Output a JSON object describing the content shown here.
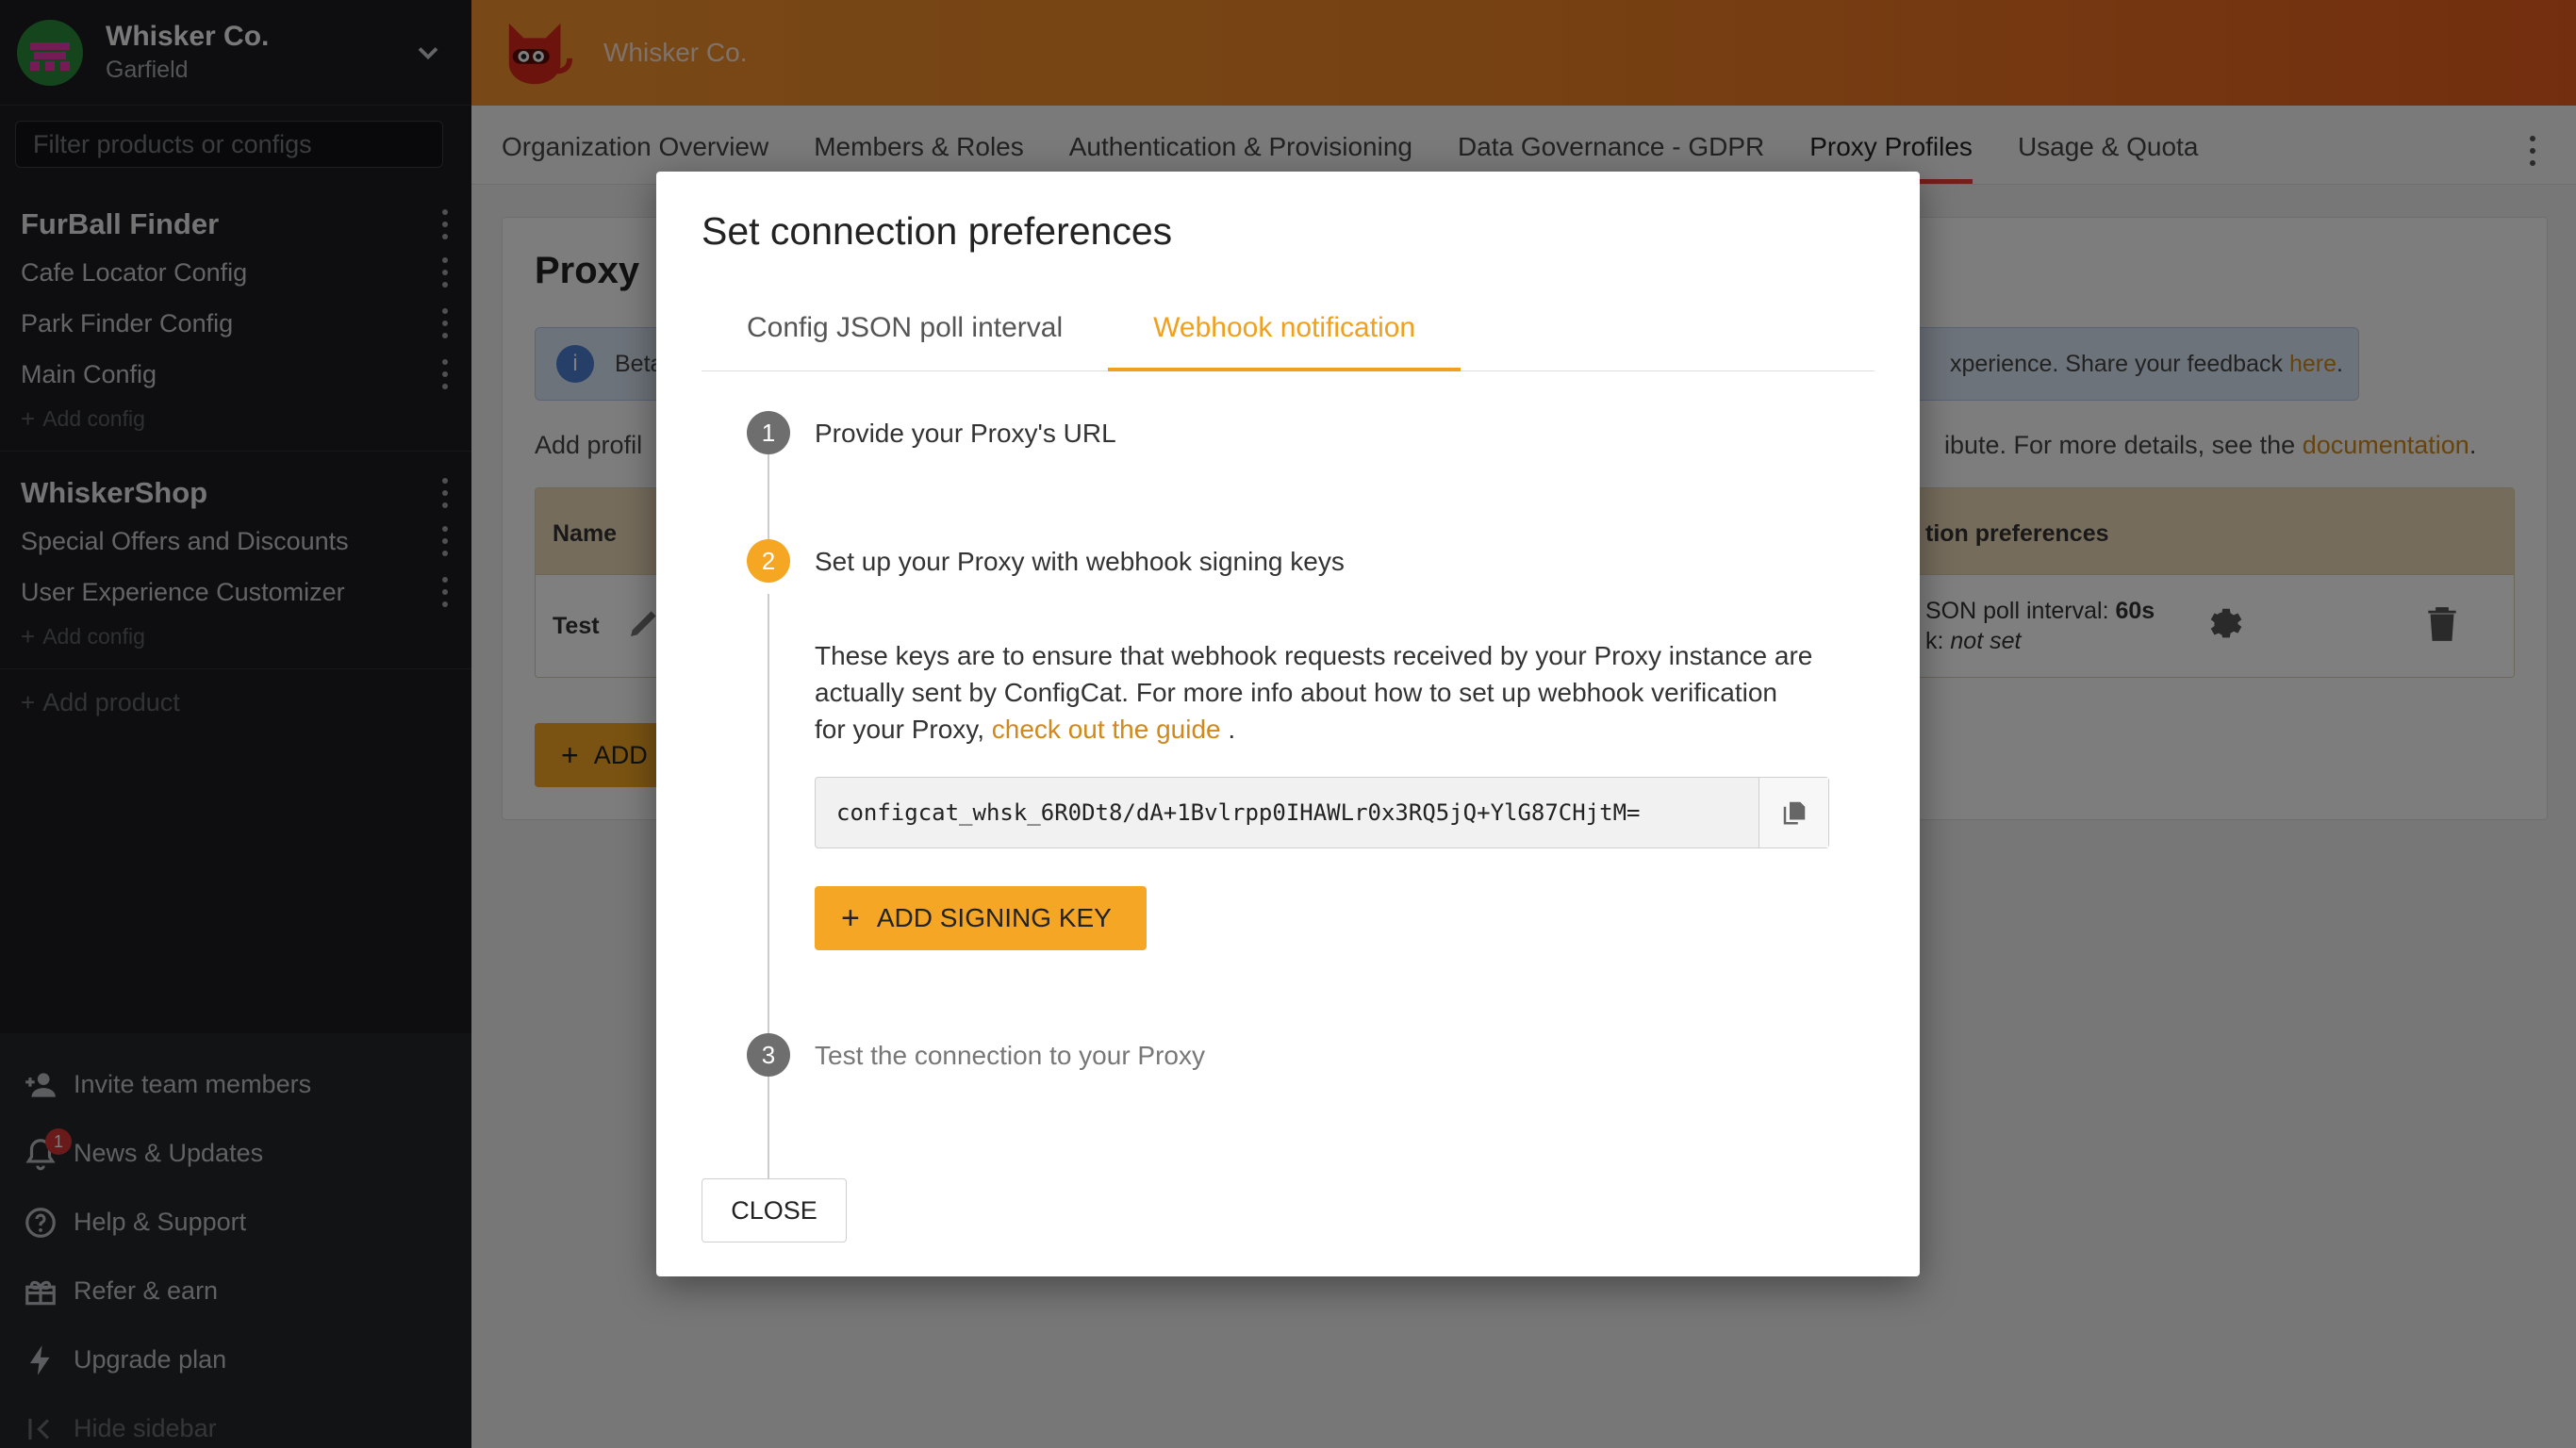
{
  "org": {
    "name": "Whisker Co.",
    "user": "Garfield"
  },
  "filter": {
    "placeholder": "Filter products or configs"
  },
  "products": [
    {
      "name": "FurBall Finder",
      "configs": [
        "Cafe Locator Config",
        "Park Finder Config",
        "Main Config"
      ],
      "add_config": "Add config"
    },
    {
      "name": "WhiskerShop",
      "configs": [
        "Special Offers and Discounts",
        "User Experience Customizer"
      ],
      "add_config": "Add config"
    }
  ],
  "add_product": "Add product",
  "bottom_nav": {
    "invite": "Invite team members",
    "news": "News & Updates",
    "news_badge": "1",
    "help": "Help & Support",
    "refer": "Refer & earn",
    "upgrade": "Upgrade plan",
    "hide": "Hide sidebar"
  },
  "topbar": {
    "title": "Whisker Co."
  },
  "tabs": [
    "Organization Overview",
    "Members & Roles",
    "Authentication & Provisioning",
    "Data Governance - GDPR",
    "Proxy Profiles",
    "Usage & Quota"
  ],
  "page": {
    "title": "Proxy",
    "beta_start": "Beta",
    "beta_end": "xperience. Share your feedback ",
    "beta_link": "here",
    "addprof_start": "Add profil",
    "addprof_end": "ibute. For more details, see the ",
    "addprof_link": "documentation",
    "table": {
      "col_name": "Name",
      "col_prefs": "tion preferences",
      "row_name": "Test",
      "row_poll_label": "SON poll interval: ",
      "row_poll_value": "60s",
      "row_webhook_label": "k: ",
      "row_webhook_value": "not set"
    },
    "add_button": "ADD"
  },
  "dialog": {
    "title": "Set connection preferences",
    "tabs": [
      "Config JSON poll interval",
      "Webhook notification"
    ],
    "steps": [
      {
        "num": "1",
        "label": "Provide your Proxy's URL"
      },
      {
        "num": "2",
        "label": "Set up your Proxy with webhook signing keys"
      },
      {
        "num": "3",
        "label": "Test the connection to your Proxy"
      }
    ],
    "description": "These keys are to ensure that webhook requests received by your Proxy instance are actually sent by ConfigCat. For more info about how to set up webhook verification for your Proxy, ",
    "guide_link": "check out the guide",
    "description_end": " .",
    "signing_key": "configcat_whsk_6R0Dt8/dA+1Bvlrpp0IHAWLr0x3RQ5jQ+YlG87CHjtM=",
    "add_key_button": "ADD SIGNING KEY",
    "close_button": "CLOSE"
  },
  "colors": {
    "accent": "#f5a624",
    "topbar": "#ee8326",
    "active_tab": "#e4432e",
    "link": "#f0a01e"
  }
}
